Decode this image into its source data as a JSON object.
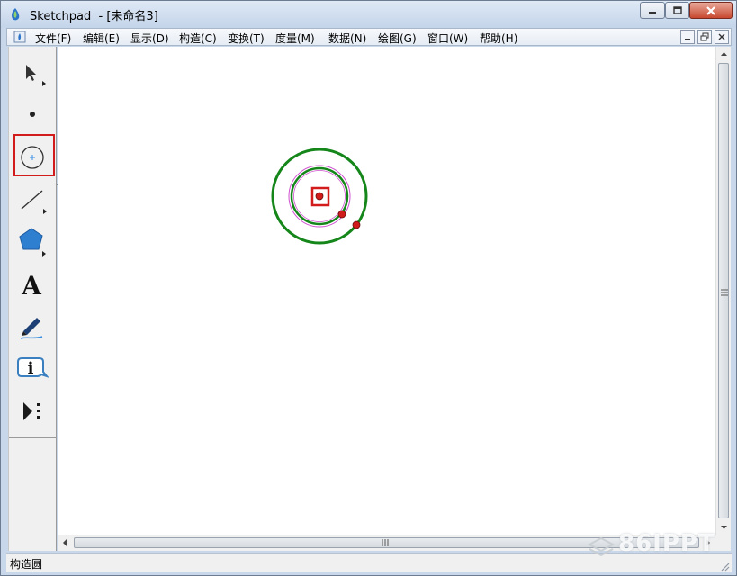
{
  "window": {
    "title": "Sketchpad  - [未命名3]",
    "controls": [
      "minimize-icon",
      "maximize-icon",
      "close-icon"
    ]
  },
  "menubar": {
    "items": [
      {
        "label": "文件(F)"
      },
      {
        "label": "编辑(E)"
      },
      {
        "label": "显示(D)"
      },
      {
        "label": "构造(C)"
      },
      {
        "label": "变换(T)"
      },
      {
        "label": "度量(M)"
      },
      {
        "label": "数据(N)"
      },
      {
        "label": "绘图(G)"
      },
      {
        "label": "窗口(W)"
      },
      {
        "label": "帮助(H)"
      }
    ]
  },
  "toolbox": {
    "tools": [
      {
        "name": "selection-arrow-tool",
        "icon": "arrow-icon"
      },
      {
        "name": "point-tool",
        "icon": "point-icon"
      },
      {
        "name": "compass-tool",
        "icon": "circle-icon",
        "selected": true
      },
      {
        "name": "straightedge-tool",
        "icon": "line-icon"
      },
      {
        "name": "polygon-tool",
        "icon": "pentagon-icon"
      },
      {
        "name": "text-tool",
        "icon": "text-a-icon",
        "glyph": "A"
      },
      {
        "name": "marker-tool",
        "icon": "marker-pen-icon"
      },
      {
        "name": "information-tool",
        "icon": "info-icon",
        "glyph": "i"
      },
      {
        "name": "custom-tool",
        "icon": "play-more-icon"
      }
    ]
  },
  "colors": {
    "outer_circle": "#15861a",
    "inner_circle": "#15861a",
    "inner_circle_highlight": "#d050d0",
    "points": "#d01b1b",
    "highlight_box": "#d21b1b"
  },
  "scrollbars": {
    "vertical_thumb": "vertical-scroll-thumb",
    "horizontal_thumb": "horizontal-scroll-thumb"
  },
  "statusbar": {
    "text": "构造圆"
  },
  "watermark": {
    "text": "86IPPT"
  }
}
